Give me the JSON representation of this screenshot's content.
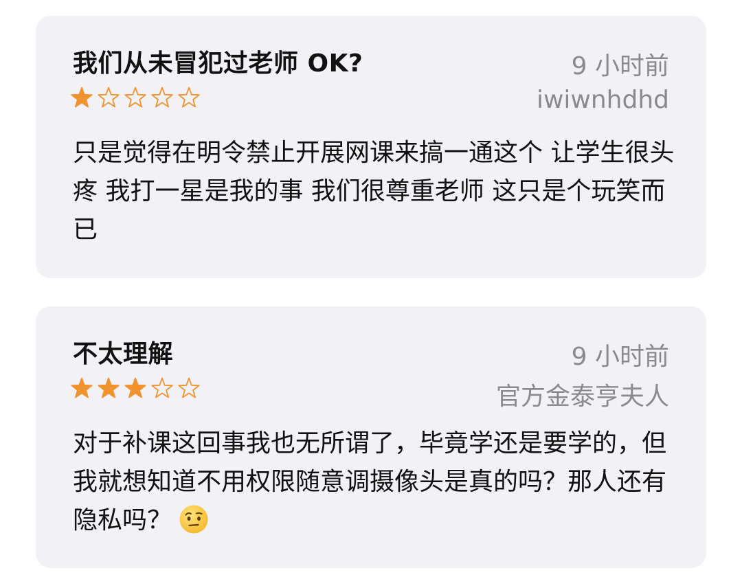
{
  "colors": {
    "card_background": "#f1f1f6",
    "star_filled": "#f0922e",
    "meta_text": "#8a8a8e",
    "body_text": "#111111"
  },
  "reviews": [
    {
      "title": "我们从未冒犯过老师 OK?",
      "time": "9 小时前",
      "author": "iwiwnhdhd",
      "rating": 1,
      "max_rating": 5,
      "body": "只是觉得在明令禁止开展网课来搞一通这个 让学生很头疼 我打一星是我的事 我们很尊重老师 这只是个玩笑而已"
    },
    {
      "title": "不太理解",
      "time": "9 小时前",
      "author": "官方金泰亨夫人",
      "rating": 3,
      "max_rating": 5,
      "body": "对于补课这回事我也无所谓了，毕竟学还是要学的，但我就想知道不用权限随意调摄像头是真的吗？那人还有隐私吗？",
      "emoji": "raised-eyebrow-face-icon"
    }
  ]
}
